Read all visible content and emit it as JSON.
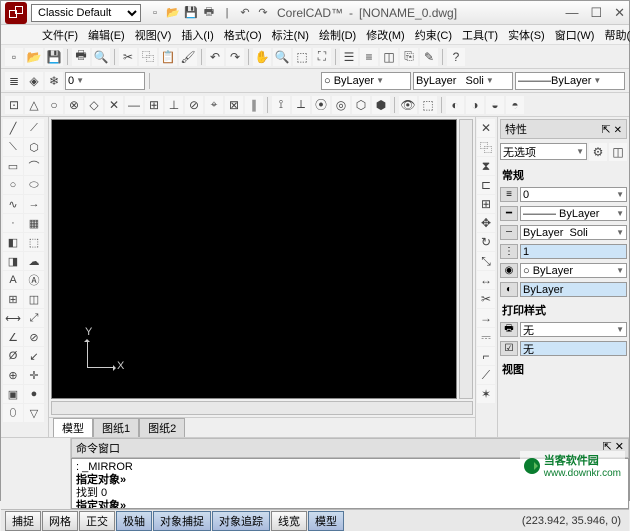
{
  "title": {
    "theme": "Classic Default",
    "app": "CorelCAD™",
    "doc": "[NONAME_0.dwg]",
    "sep": "-"
  },
  "menu": {
    "file": "文件(F)",
    "edit": "编辑(E)",
    "view": "视图(V)",
    "insert": "插入(I)",
    "format": "格式(O)",
    "annotate": "标注(N)",
    "draw": "绘制(D)",
    "modify": "修改(M)",
    "constrain": "约束(C)",
    "tools": "工具(T)",
    "entity": "实体(S)",
    "window": "窗口(W)",
    "help": "帮助(H)"
  },
  "layerbar": {
    "layer_value": "○ ByLayer",
    "ltype_label": "ByLayer",
    "ltype_style": "Soli",
    "lweight": "———ByLayer"
  },
  "tabs": {
    "model": "模型",
    "layout1": "图纸1",
    "layout2": "图纸2"
  },
  "props": {
    "title": "特性",
    "nosel": "无选项",
    "general": "常规",
    "r1": "0",
    "r2": "——— ByLayer",
    "r3_a": "ByLayer",
    "r3_b": "Soli",
    "r4": "1",
    "r5": "○ ByLayer",
    "r6": "ByLayer",
    "print_title": "打印样式",
    "p1": "无",
    "p2": "无",
    "view_title": "视图"
  },
  "cmd": {
    "title": "命令窗口",
    "l1": ": _MIRROR",
    "l2": "指定对象»",
    "l3": "找到 0",
    "l4": "指定对象»"
  },
  "status": {
    "snap": "捕捉",
    "grid": "网格",
    "ortho": "正交",
    "polar": "极轴",
    "osnap": "对象捕捉",
    "otrack": "对象追踪",
    "lwt": "线宽",
    "model": "模型",
    "coords": "(223.942, 35.946, 0)"
  },
  "watermark": {
    "cn": "当客软件园",
    "url": "www.downkr.com"
  },
  "ucs": {
    "x": "X",
    "y": "Y"
  },
  "window": {
    "min": "—",
    "max": "☐",
    "close": "✕"
  }
}
